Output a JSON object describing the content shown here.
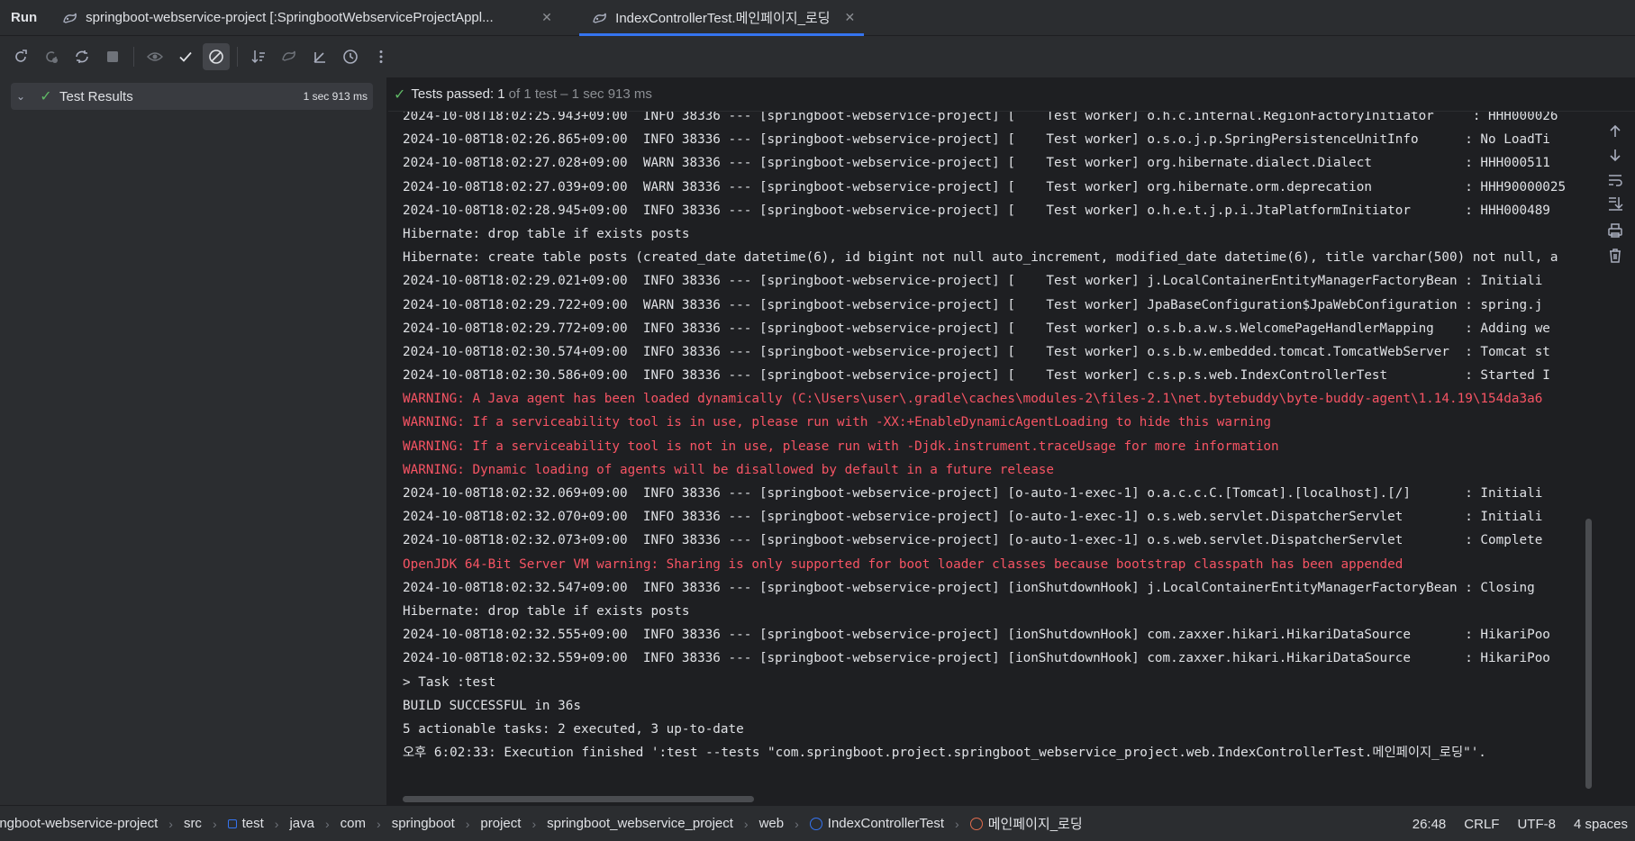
{
  "tabs": {
    "run_label": "Run",
    "items": [
      {
        "label": "springboot-webservice-project [:SpringbootWebserviceProjectAppl...",
        "active": false
      },
      {
        "label": "IndexControllerTest.메인페이지_로딩",
        "active": true
      }
    ]
  },
  "tree": {
    "root_label": "Test Results",
    "root_time": "1 sec 913 ms"
  },
  "status": {
    "prefix": "Tests passed:",
    "count": "1",
    "rest": "of 1 test – 1 sec 913 ms"
  },
  "log": [
    {
      "t": "2024-10-08T18:02:25.943+09:00  INFO 38336 --- [springboot-webservice-project] [    Test worker] o.h.c.internal.RegionFactoryInitiator     : HHH000026",
      "w": false
    },
    {
      "t": "2024-10-08T18:02:26.865+09:00  INFO 38336 --- [springboot-webservice-project] [    Test worker] o.s.o.j.p.SpringPersistenceUnitInfo      : No LoadTi",
      "w": false
    },
    {
      "t": "2024-10-08T18:02:27.028+09:00  WARN 38336 --- [springboot-webservice-project] [    Test worker] org.hibernate.dialect.Dialect            : HHH000511",
      "w": false
    },
    {
      "t": "2024-10-08T18:02:27.039+09:00  WARN 38336 --- [springboot-webservice-project] [    Test worker] org.hibernate.orm.deprecation            : HHH90000025",
      "w": false
    },
    {
      "t": "2024-10-08T18:02:28.945+09:00  INFO 38336 --- [springboot-webservice-project] [    Test worker] o.h.e.t.j.p.i.JtaPlatformInitiator       : HHH000489",
      "w": false
    },
    {
      "t": "Hibernate: drop table if exists posts",
      "w": false
    },
    {
      "t": "Hibernate: create table posts (created_date datetime(6), id bigint not null auto_increment, modified_date datetime(6), title varchar(500) not null, a",
      "w": false
    },
    {
      "t": "2024-10-08T18:02:29.021+09:00  INFO 38336 --- [springboot-webservice-project] [    Test worker] j.LocalContainerEntityManagerFactoryBean : Initiali",
      "w": false
    },
    {
      "t": "2024-10-08T18:02:29.722+09:00  WARN 38336 --- [springboot-webservice-project] [    Test worker] JpaBaseConfiguration$JpaWebConfiguration : spring.j",
      "w": false
    },
    {
      "t": "2024-10-08T18:02:29.772+09:00  INFO 38336 --- [springboot-webservice-project] [    Test worker] o.s.b.a.w.s.WelcomePageHandlerMapping    : Adding we",
      "w": false
    },
    {
      "t": "2024-10-08T18:02:30.574+09:00  INFO 38336 --- [springboot-webservice-project] [    Test worker] o.s.b.w.embedded.tomcat.TomcatWebServer  : Tomcat st",
      "w": false
    },
    {
      "t": "2024-10-08T18:02:30.586+09:00  INFO 38336 --- [springboot-webservice-project] [    Test worker] c.s.p.s.web.IndexControllerTest          : Started I",
      "w": false
    },
    {
      "t": "WARNING: A Java agent has been loaded dynamically (C:\\Users\\user\\.gradle\\caches\\modules-2\\files-2.1\\net.bytebuddy\\byte-buddy-agent\\1.14.19\\154da3a6",
      "w": true
    },
    {
      "t": "WARNING: If a serviceability tool is in use, please run with -XX:+EnableDynamicAgentLoading to hide this warning",
      "w": true
    },
    {
      "t": "WARNING: If a serviceability tool is not in use, please run with -Djdk.instrument.traceUsage for more information",
      "w": true
    },
    {
      "t": "WARNING: Dynamic loading of agents will be disallowed by default in a future release",
      "w": true
    },
    {
      "t": "2024-10-08T18:02:32.069+09:00  INFO 38336 --- [springboot-webservice-project] [o-auto-1-exec-1] o.a.c.c.C.[Tomcat].[localhost].[/]       : Initiali",
      "w": false
    },
    {
      "t": "2024-10-08T18:02:32.070+09:00  INFO 38336 --- [springboot-webservice-project] [o-auto-1-exec-1] o.s.web.servlet.DispatcherServlet        : Initiali",
      "w": false
    },
    {
      "t": "2024-10-08T18:02:32.073+09:00  INFO 38336 --- [springboot-webservice-project] [o-auto-1-exec-1] o.s.web.servlet.DispatcherServlet        : Complete",
      "w": false
    },
    {
      "t": "OpenJDK 64-Bit Server VM warning: Sharing is only supported for boot loader classes because bootstrap classpath has been appended",
      "w": true
    },
    {
      "t": "2024-10-08T18:02:32.547+09:00  INFO 38336 --- [springboot-webservice-project] [ionShutdownHook] j.LocalContainerEntityManagerFactoryBean : Closing ",
      "w": false
    },
    {
      "t": "Hibernate: drop table if exists posts",
      "w": false
    },
    {
      "t": "2024-10-08T18:02:32.555+09:00  INFO 38336 --- [springboot-webservice-project] [ionShutdownHook] com.zaxxer.hikari.HikariDataSource       : HikariPoo",
      "w": false
    },
    {
      "t": "2024-10-08T18:02:32.559+09:00  INFO 38336 --- [springboot-webservice-project] [ionShutdownHook] com.zaxxer.hikari.HikariDataSource       : HikariPoo",
      "w": false
    },
    {
      "t": "> Task :test",
      "w": false
    },
    {
      "t": "BUILD SUCCESSFUL in 36s",
      "w": false
    },
    {
      "t": "5 actionable tasks: 2 executed, 3 up-to-date",
      "w": false
    },
    {
      "t": "오후 6:02:33: Execution finished ':test --tests \"com.springboot.project.springboot_webservice_project.web.IndexControllerTest.메인페이지_로딩\"'.",
      "w": false
    }
  ],
  "breadcrumbs": [
    "ingboot-webservice-project",
    "src",
    "test",
    "java",
    "com",
    "springboot",
    "project",
    "springboot_webservice_project",
    "web",
    "IndexControllerTest",
    "메인페이지_로딩"
  ],
  "statusbar": {
    "position": "26:48",
    "line_sep": "CRLF",
    "encoding": "UTF-8",
    "indent": "4 spaces"
  },
  "colors": {
    "accent": "#3574f0",
    "pass": "#5fb865",
    "warn_text": "#f75464"
  }
}
